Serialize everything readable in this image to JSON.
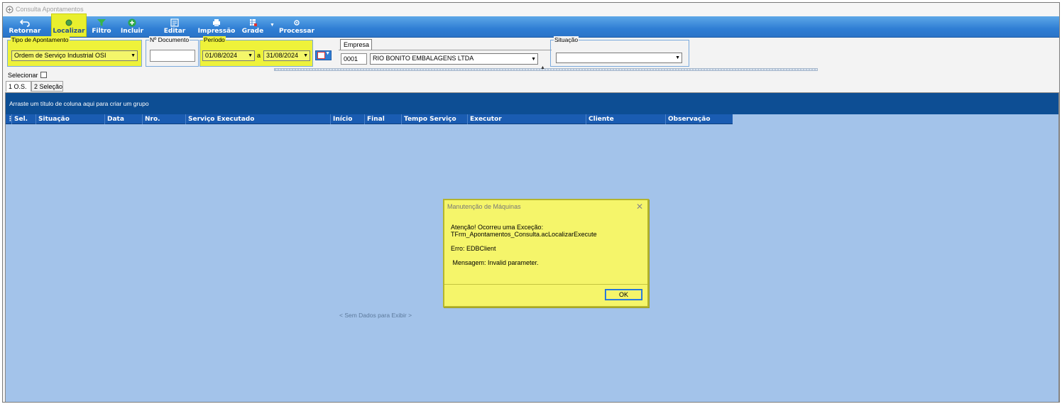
{
  "window": {
    "title": "Consulta Apontamentos"
  },
  "toolbar": {
    "retornar": "Retornar",
    "localizar": "Localizar",
    "filtro": "Filtro",
    "incluir": "Incluir",
    "editar": "Editar",
    "impressao": "Impressão",
    "grade": "Grade",
    "processar": "Processar"
  },
  "filters": {
    "tipo_label": "Tipo de Apontamento",
    "tipo_value": "Ordem de Serviço Industrial OSI",
    "documento_label": "Nº Documento",
    "documento_value": "",
    "periodo_label": "Período",
    "periodo_from": "01/08/2024",
    "periodo_sep": "a",
    "periodo_to": "31/08/2024",
    "empresa_label": "Empresa",
    "empresa_code": "0001",
    "empresa_name": "RIO BONITO EMBALAGENS LTDA",
    "situacao_label": "Situação",
    "situacao_value": ""
  },
  "selecionar_label": "Selecionar",
  "tabs": [
    {
      "label": "1 O.S."
    },
    {
      "label": "2 Seleção"
    }
  ],
  "grid": {
    "group_hint": "Arraste um título de coluna aqui para criar um grupo",
    "columns": [
      "Sel.",
      "Situação",
      "Data",
      "Nro.",
      "Serviço Executado",
      "Início",
      "Final",
      "Tempo Serviço",
      "Executor",
      "Cliente",
      "Observação"
    ],
    "no_data": "< Sem Dados para Exibir >"
  },
  "dialog": {
    "title": "Manutenção de Máquinas",
    "line1": "Atenção! Ocorreu uma Exceção:",
    "line2": "TFrm_Apontamentos_Consulta.acLocalizarExecute",
    "line3": "Erro: EDBClient",
    "line4": " Mensagem: Invalid parameter.",
    "ok": "OK"
  },
  "colors": {
    "toolbar": "#2f7ed4",
    "grid_bg": "#a3c3ea",
    "highlight": "#eef23a",
    "header": "#1a5cb2"
  }
}
